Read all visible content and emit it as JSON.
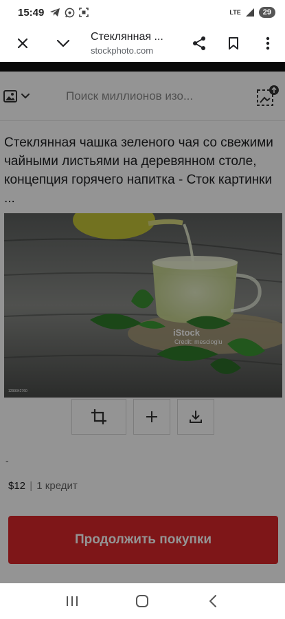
{
  "status_bar": {
    "time": "15:49",
    "network": "LTE",
    "battery": "29"
  },
  "header": {
    "title": "Стеклянная ...",
    "url": "stockphoto.com"
  },
  "search": {
    "placeholder": "Поиск миллионов изо..."
  },
  "image": {
    "title": "Стеклянная чашка зеленого чая со свежими чайными листьями на деревянном столе, концепция горячего напитка - Сток картинки  ...",
    "watermark": "iStock",
    "credit": "Credit: mescioglu",
    "id": "1299342760"
  },
  "dash": "-",
  "pricing": {
    "price": "$12",
    "separator": "|",
    "credits": "1 кредит"
  },
  "buy_button": "Продолжить покупки",
  "colors": {
    "accent": "#d9262a",
    "overlay": "rgba(0,0,0,0.42)"
  }
}
